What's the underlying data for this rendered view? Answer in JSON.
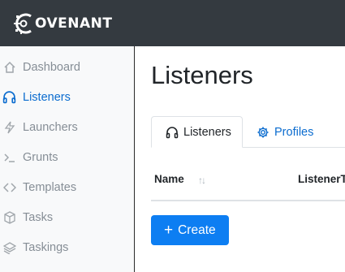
{
  "app": {
    "logo_text": "OVENANT"
  },
  "sidebar": {
    "items": [
      {
        "label": "Dashboard",
        "icon": "home-icon",
        "active": false
      },
      {
        "label": "Listeners",
        "icon": "headphones-icon",
        "active": true
      },
      {
        "label": "Launchers",
        "icon": "lightning-icon",
        "active": false
      },
      {
        "label": "Grunts",
        "icon": "terminal-icon",
        "active": false
      },
      {
        "label": "Templates",
        "icon": "code-icon",
        "active": false
      },
      {
        "label": "Tasks",
        "icon": "box-icon",
        "active": false
      },
      {
        "label": "Taskings",
        "icon": "layers-icon",
        "active": false
      }
    ]
  },
  "main": {
    "title": "Listeners",
    "tabs": [
      {
        "label": "Listeners",
        "icon": "headphones-icon",
        "active": true
      },
      {
        "label": "Profiles",
        "icon": "gear-icon",
        "active": false
      }
    ],
    "table": {
      "columns": [
        "Name",
        "ListenerT"
      ],
      "sort_glyph": "↑↓"
    },
    "create_button": {
      "label": "Create",
      "icon": "plus-icon"
    }
  },
  "colors": {
    "topbar": "#343a40",
    "accent": "#0d7ef2",
    "link": "#0b6ccf",
    "sidebar_bg": "#f8f9fa",
    "muted": "#868e96"
  }
}
